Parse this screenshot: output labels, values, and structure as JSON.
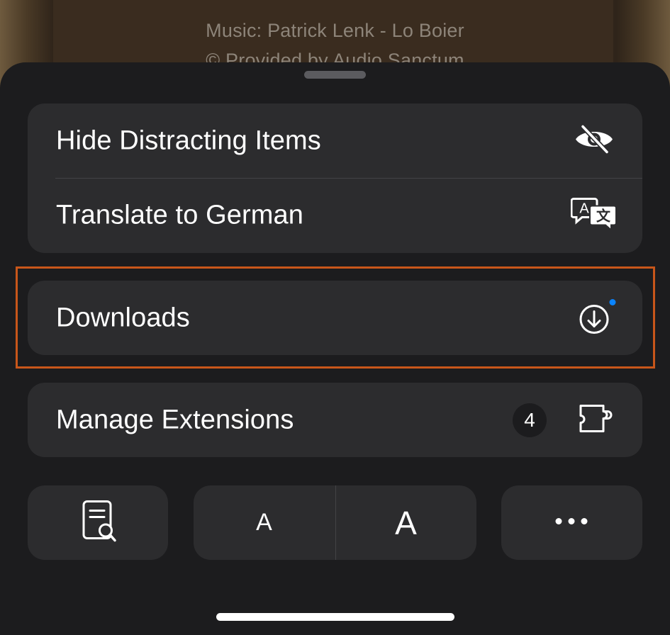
{
  "background_page": {
    "line1": "Music: Patrick Lenk - Lo Boier",
    "line2": "© Provided by Audio Sanctum"
  },
  "menu": {
    "hide_distracting": {
      "label": "Hide Distracting Items",
      "icon": "eye-slash-icon"
    },
    "translate": {
      "label": "Translate to German",
      "icon": "translate-icon"
    },
    "downloads": {
      "label": "Downloads",
      "icon": "download-circle-icon",
      "indicator_color": "#0a84ff"
    },
    "extensions": {
      "label": "Manage Extensions",
      "count": "4",
      "icon": "puzzle-icon"
    }
  },
  "toolbar": {
    "reader_icon": "document-search-icon",
    "font_smaller": "A",
    "font_larger": "A",
    "more_icon": "ellipsis-icon"
  },
  "colors": {
    "sheet_bg": "#1c1c1e",
    "cell_bg": "#2c2c2e",
    "highlight": "#c8561a",
    "accent_dot": "#0a84ff"
  }
}
